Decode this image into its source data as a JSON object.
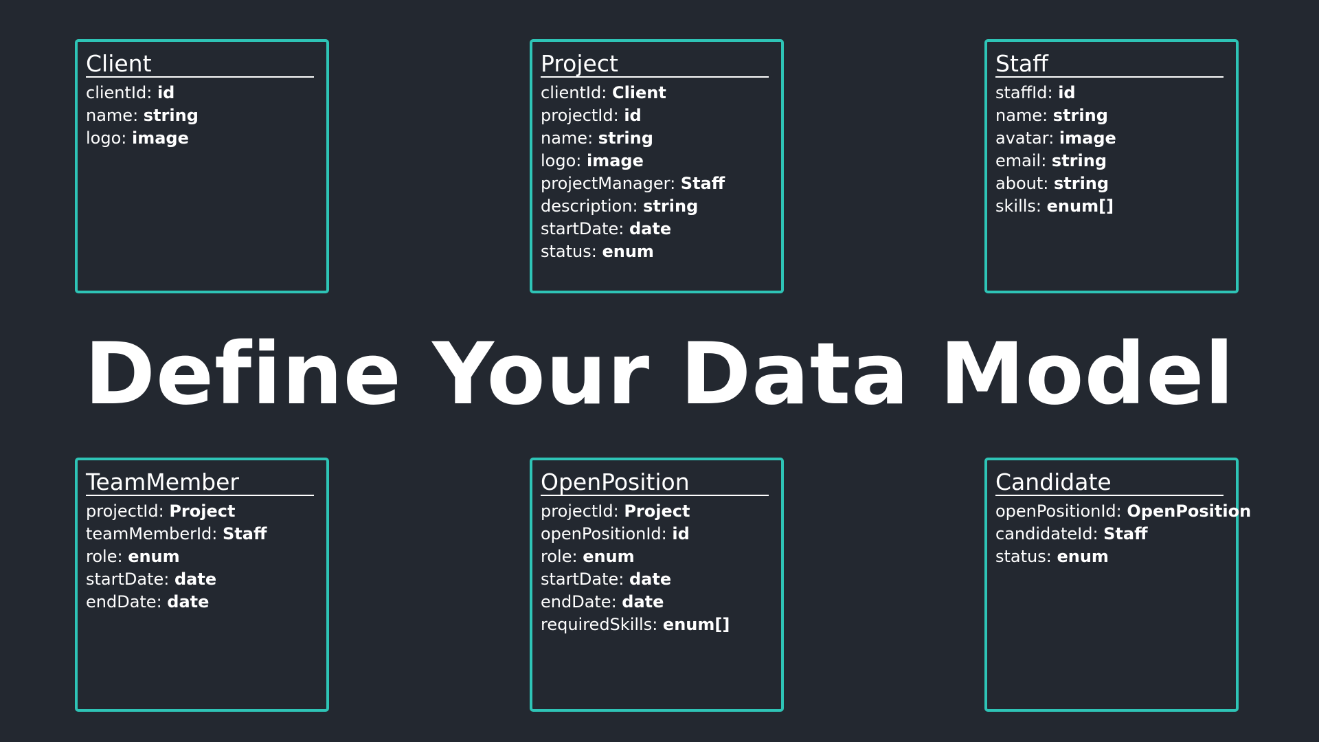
{
  "title": "Define Your Data Model",
  "accent_color": "#2ec4b6",
  "background_color": "#232830",
  "entities": [
    {
      "name": "Client",
      "fields": [
        {
          "name": "clientId",
          "type": "id"
        },
        {
          "name": "name",
          "type": "string"
        },
        {
          "name": "logo",
          "type": "image"
        }
      ]
    },
    {
      "name": "Project",
      "fields": [
        {
          "name": "clientId",
          "type": "Client"
        },
        {
          "name": "projectId",
          "type": "id"
        },
        {
          "name": "name",
          "type": "string"
        },
        {
          "name": "logo",
          "type": "image"
        },
        {
          "name": "projectManager",
          "type": "Staff"
        },
        {
          "name": "description",
          "type": "string"
        },
        {
          "name": "startDate",
          "type": "date"
        },
        {
          "name": "status",
          "type": "enum"
        }
      ]
    },
    {
      "name": "Staff",
      "fields": [
        {
          "name": "staffId",
          "type": "id"
        },
        {
          "name": "name",
          "type": "string"
        },
        {
          "name": "avatar",
          "type": "image"
        },
        {
          "name": "email",
          "type": "string"
        },
        {
          "name": "about",
          "type": "string"
        },
        {
          "name": "skills",
          "type": "enum[]"
        }
      ]
    },
    {
      "name": "TeamMember",
      "fields": [
        {
          "name": "projectId",
          "type": "Project"
        },
        {
          "name": "teamMemberId",
          "type": "Staff"
        },
        {
          "name": "role",
          "type": "enum"
        },
        {
          "name": "startDate",
          "type": "date"
        },
        {
          "name": "endDate",
          "type": "date"
        }
      ]
    },
    {
      "name": "OpenPosition",
      "fields": [
        {
          "name": "projectId",
          "type": "Project"
        },
        {
          "name": "openPositionId",
          "type": "id"
        },
        {
          "name": "role",
          "type": "enum"
        },
        {
          "name": "startDate",
          "type": "date"
        },
        {
          "name": "endDate",
          "type": "date"
        },
        {
          "name": "requiredSkills",
          "type": "enum[]"
        }
      ]
    },
    {
      "name": "Candidate",
      "fields": [
        {
          "name": "openPositionId",
          "type": "OpenPosition"
        },
        {
          "name": "candidateId",
          "type": "Staff"
        },
        {
          "name": "status",
          "type": "enum"
        }
      ]
    }
  ]
}
